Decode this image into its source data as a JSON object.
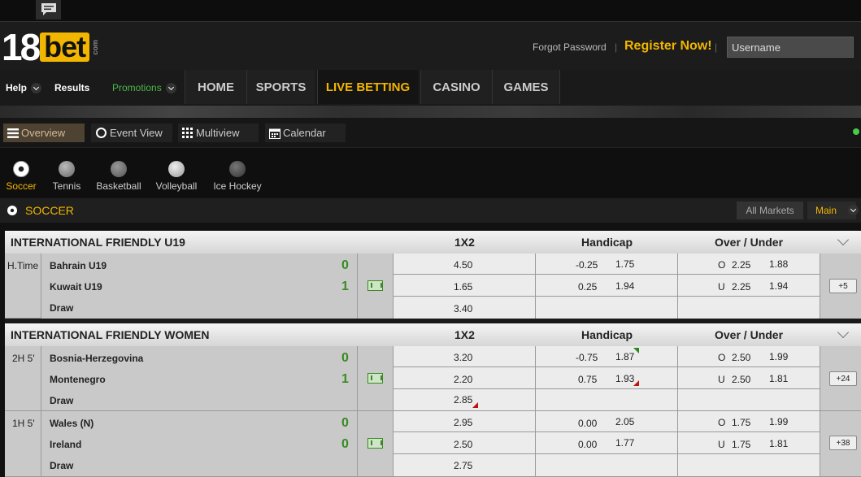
{
  "header": {
    "forgot": "Forgot Password",
    "register": "Register Now!",
    "username_placeholder": "Username",
    "logo": {
      "num": "18",
      "word": "bet",
      "suffix": "com"
    }
  },
  "nav": {
    "small": [
      {
        "label": "Help"
      },
      {
        "label": "Results"
      },
      {
        "label": "Promotions"
      }
    ],
    "main": [
      {
        "label": "HOME"
      },
      {
        "label": "SPORTS"
      },
      {
        "label": "LIVE BETTING"
      },
      {
        "label": "CASINO"
      },
      {
        "label": "GAMES"
      }
    ]
  },
  "subnav": [
    {
      "label": "Overview"
    },
    {
      "label": "Event View"
    },
    {
      "label": "Multiview"
    },
    {
      "label": "Calendar"
    }
  ],
  "sports": [
    {
      "label": "Soccer"
    },
    {
      "label": "Tennis"
    },
    {
      "label": "Basketball"
    },
    {
      "label": "Volleyball"
    },
    {
      "label": "Ice Hockey"
    }
  ],
  "section": {
    "title": "SOCCER",
    "all_markets": "All Markets",
    "main": "Main"
  },
  "leagues": [
    {
      "name": "INTERNATIONAL FRIENDLY U19",
      "col1": "1X2",
      "col2": "Handicap",
      "col3": "Over / Under",
      "matches": [
        {
          "time": "H.Time",
          "home": "Bahrain U19",
          "away": "Kuwait U19",
          "draw": "Draw",
          "home_score": "0",
          "away_score": "1",
          "odds_1x2": [
            "4.50",
            "1.65",
            "3.40"
          ],
          "hdp_line": [
            "-0.25",
            "0.25"
          ],
          "hdp_odds": [
            "1.75",
            "1.94"
          ],
          "ou_side": [
            "O",
            "U"
          ],
          "ou_line": [
            "2.25",
            "2.25"
          ],
          "ou_odds": [
            "1.88",
            "1.94"
          ],
          "more": "+5"
        }
      ]
    },
    {
      "name": "INTERNATIONAL FRIENDLY WOMEN",
      "col1": "1X2",
      "col2": "Handicap",
      "col3": "Over / Under",
      "matches": [
        {
          "time": "2H 5'",
          "home": "Bosnia-Herzegovina",
          "away": "Montenegro",
          "draw": "Draw",
          "home_score": "0",
          "away_score": "1",
          "odds_1x2": [
            "3.20",
            "2.20",
            "2.85"
          ],
          "hdp_line": [
            "-0.75",
            "0.75"
          ],
          "hdp_odds": [
            "1.87",
            "1.93"
          ],
          "ou_side": [
            "O",
            "U"
          ],
          "ou_line": [
            "2.50",
            "2.50"
          ],
          "ou_odds": [
            "1.99",
            "1.81"
          ],
          "more": "+24"
        },
        {
          "time": "1H 5'",
          "home": "Wales (N)",
          "away": "Ireland",
          "draw": "Draw",
          "home_score": "0",
          "away_score": "0",
          "odds_1x2": [
            "2.95",
            "2.50",
            "2.75"
          ],
          "hdp_line": [
            "0.00",
            "0.00"
          ],
          "hdp_odds": [
            "2.05",
            "1.77"
          ],
          "ou_side": [
            "O",
            "U"
          ],
          "ou_line": [
            "1.75",
            "1.75"
          ],
          "ou_odds": [
            "1.99",
            "1.81"
          ],
          "more": "+38"
        }
      ]
    }
  ],
  "colors": {
    "accent": "#f2b600",
    "score": "#3a8a25",
    "up": "#2a8a1a",
    "down": "#c01010"
  }
}
